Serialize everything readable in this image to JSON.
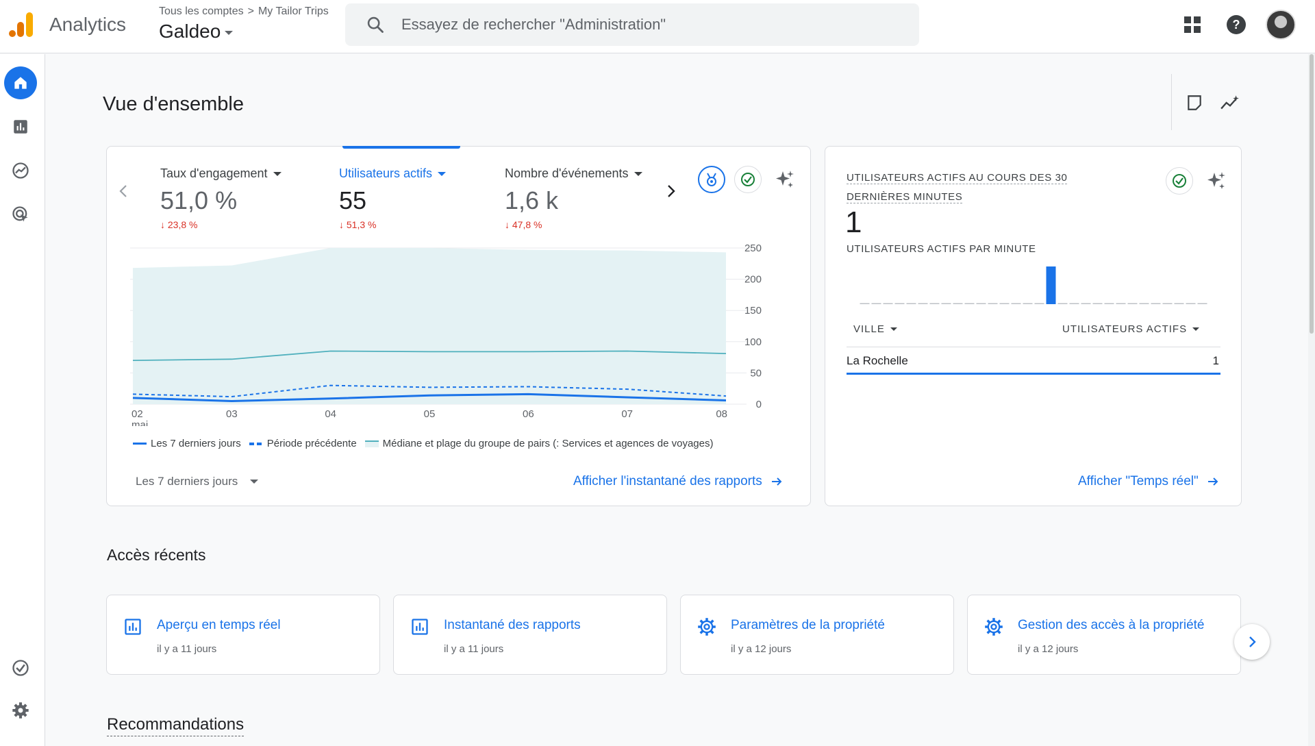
{
  "topbar": {
    "brand": "Analytics",
    "breadcrumb_account": "Tous les comptes",
    "breadcrumb_sep": ">",
    "breadcrumb_property": "My Tailor Trips",
    "property_name": "Galdeo",
    "search_placeholder": "Essayez de rechercher \"Administration\"",
    "icons": [
      "apps-icon",
      "help-icon",
      "account-avatar"
    ]
  },
  "rail": {
    "items": [
      "home-icon",
      "reports-icon",
      "explore-icon",
      "advertising-icon",
      "admin-check-icon",
      "settings-gear-icon"
    ],
    "active": "home-icon"
  },
  "page": {
    "title": "Vue d'ensemble"
  },
  "overview_card": {
    "metrics": [
      {
        "label": "Taux d'engagement",
        "value": "51,0 %",
        "delta": "↓ 23,8 %"
      },
      {
        "label": "Utilisateurs actifs",
        "value": "55",
        "delta": "↓ 51,3 %"
      },
      {
        "label": "Nombre d'événements",
        "value": "1,6 k",
        "delta": "↓ 47,8 %"
      }
    ],
    "active_metric": "Utilisateurs actifs",
    "legend": {
      "current": "Les 7 derniers jours",
      "previous": "Période précédente",
      "benchmark": "Médiane et plage du groupe de pairs (: Services et agences de voyages)"
    },
    "date_range": "Les 7 derniers jours",
    "link": "Afficher l'instantané des rapports"
  },
  "chart_data": {
    "type": "line",
    "x": [
      "02",
      "03",
      "04",
      "05",
      "06",
      "07",
      "08"
    ],
    "x_sub_first": "mai",
    "y_ticks": [
      "250",
      "200",
      "150",
      "100",
      "50",
      "0"
    ],
    "ylim": [
      0,
      250
    ],
    "series": [
      {
        "name": "Les 7 derniers jours",
        "style": "solid",
        "color": "#1a73e8",
        "values": [
          10,
          5,
          9,
          14,
          16,
          11,
          6
        ]
      },
      {
        "name": "Période précédente",
        "style": "dashed",
        "color": "#1a73e8",
        "values": [
          16,
          12,
          30,
          27,
          28,
          24,
          13
        ]
      },
      {
        "name": "Médiane et plage du groupe de pairs (: Services et agences de voyages)",
        "style": "median",
        "color": "#4fb0bd",
        "values": [
          70,
          72,
          85,
          84,
          84,
          85,
          81
        ]
      }
    ],
    "band_upper": [
      218,
      222,
      250,
      250,
      247,
      246,
      243
    ],
    "band_lower": [
      0,
      0,
      0,
      0,
      0,
      0,
      0
    ],
    "grid": true
  },
  "realtime_card": {
    "title": "UTILISATEURS ACTIFS AU COURS DES 30 DERNIÈRES MINUTES",
    "value": "1",
    "subtitle": "UTILISATEURS ACTIFS PAR MINUTE",
    "minute_bars": [
      0,
      0,
      0,
      0,
      0,
      0,
      0,
      0,
      0,
      0,
      0,
      0,
      0,
      0,
      0,
      0,
      1,
      0,
      0,
      0,
      0,
      0,
      0,
      0,
      0,
      0,
      0,
      0,
      0,
      0
    ],
    "col_city": "VILLE",
    "col_users": "UTILISATEURS ACTIFS",
    "rows": [
      {
        "city": "La Rochelle",
        "users": "1"
      }
    ],
    "link": "Afficher \"Temps réel\""
  },
  "recent": {
    "title": "Accès récents",
    "items": [
      {
        "icon": "report-chart-icon",
        "name": "Aperçu en temps réel",
        "time": "il y a 11 jours"
      },
      {
        "icon": "report-chart-icon",
        "name": "Instantané des rapports",
        "time": "il y a 11 jours"
      },
      {
        "icon": "settings-gear-icon",
        "name": "Paramètres de la propriété",
        "time": "il y a 12 jours"
      },
      {
        "icon": "settings-gear-icon",
        "name": "Gestion des accès à la propriété",
        "time": "il y a 12 jours"
      }
    ]
  },
  "recommendations": {
    "title": "Recommandations"
  },
  "colors": {
    "accent": "#1a73e8",
    "negative": "#d93025",
    "benchmark": "#4fb0bd",
    "logo_orange": "#f9ab00",
    "logo_dark": "#e37400"
  }
}
